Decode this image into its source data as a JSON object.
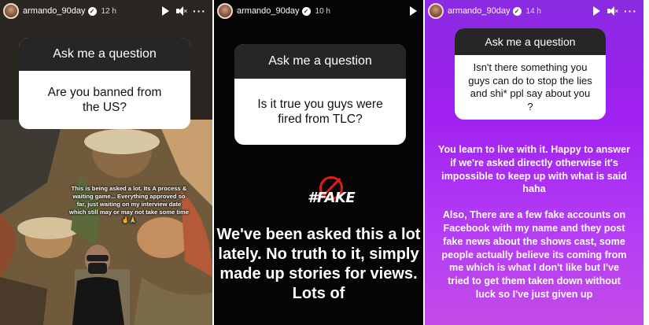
{
  "stories": [
    {
      "username": "armando_90day",
      "time": "12 h",
      "question_title": "Ask me a question",
      "question": "Are you banned from the US?",
      "answer": "This is being asked a lot. Its A process & waiting game... Everything approved so far, just waiting on my interview date which still may or may not take some time 🤞🙏"
    },
    {
      "username": "armando_90day",
      "time": "10 h",
      "question_title": "Ask me a question",
      "question": "Is it true you guys were fired from TLC?",
      "sticker": "#FAKE",
      "answer": "We've been asked this a lot lately. No truth to it, simply made up stories for views. Lots of"
    },
    {
      "username": "armando_90day",
      "time": "14 h",
      "question_title": "Ask me a question",
      "question": "Isn't there something you guys can do to stop the lies and shi* ppl say about you ?",
      "answer_p1": "You learn to live with it. Happy to answer if we're asked directly otherwise it's impossible to keep up with what is said haha",
      "answer_p2": "Also, There are a few fake accounts on Facebook with my name and they post fake news about the shows cast, some people actually believe its coming from me which is what I don't like but I've tried to get them taken down without luck so I've just given up"
    }
  ],
  "icons": {
    "verified": "verified-badge-icon",
    "play": "play-icon",
    "mute": "speaker-muted-icon",
    "more": "more-options-icon",
    "fake": "prohibited-icon"
  },
  "colors": {
    "question_header": "#262626",
    "story3_bg": "#a020f0",
    "fake_red": "#e21b1b"
  }
}
